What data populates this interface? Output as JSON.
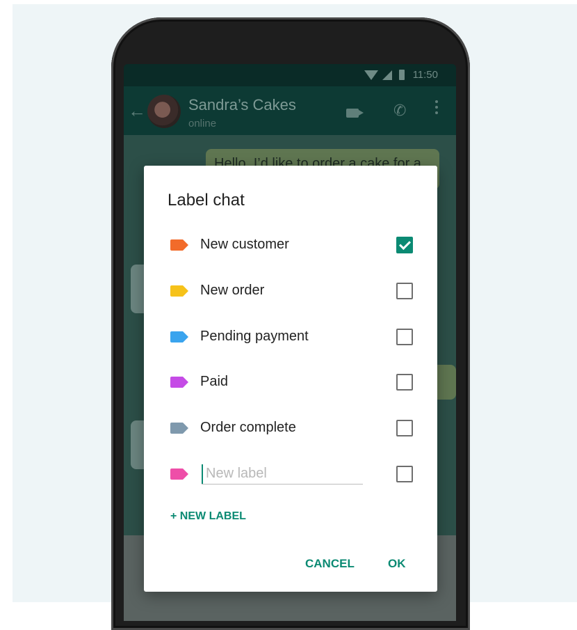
{
  "status_bar": {
    "time": "11:50"
  },
  "chat_header": {
    "name": "Sandra’s Cakes",
    "status": "online"
  },
  "message_preview": "Hello, I’d like to order a cake for a",
  "dialog": {
    "title": "Label chat",
    "labels": [
      {
        "name": "New customer",
        "color": "#f26b2a",
        "checked": true
      },
      {
        "name": "New order",
        "color": "#f6c21a",
        "checked": false
      },
      {
        "name": "Pending payment",
        "color": "#3aa4ee",
        "checked": false
      },
      {
        "name": "Paid",
        "color": "#c54be6",
        "checked": false
      },
      {
        "name": "Order complete",
        "color": "#7f99ad",
        "checked": false
      }
    ],
    "new_label": {
      "placeholder": "New label",
      "color": "#ee4ea8",
      "checked": false
    },
    "add_label_button": "+ NEW LABEL",
    "cancel_button": "CANCEL",
    "ok_button": "OK"
  },
  "colors": {
    "accent": "#0b8a73"
  }
}
